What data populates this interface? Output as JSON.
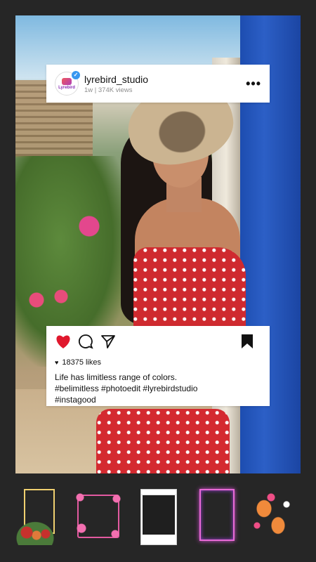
{
  "post": {
    "username": "lyrebird_studio",
    "meta": "1w | 374K views",
    "avatar_text": "Lyrebird",
    "likes": "18375 likes",
    "caption": "Life has limitless range of colors.",
    "hashtags_line1": "#belimitless #photoedit #lyrebirdstudio",
    "hashtags_line2": "#instagood"
  },
  "icons": {
    "more": "more-horizontal-icon",
    "like": "heart-icon",
    "comment": "comment-icon",
    "share": "send-icon",
    "save": "bookmark-icon",
    "verified": "verified-badge-icon"
  },
  "colors": {
    "like_red": "#e0182d",
    "verified_blue": "#3897f0",
    "background": "#262626"
  },
  "frames": [
    {
      "name": "floral-gold-frame"
    },
    {
      "name": "pink-flower-frame"
    },
    {
      "name": "instagram-post-frame"
    },
    {
      "name": "neon-pink-frame"
    },
    {
      "name": "koi-fish-frame"
    }
  ]
}
